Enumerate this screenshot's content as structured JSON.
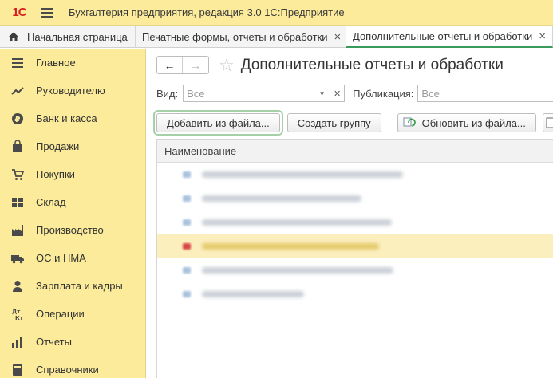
{
  "app": {
    "logo_text": "1С",
    "title": "Бухгалтерия предприятия, редакция 3.0 1С:Предприятие"
  },
  "tabs": [
    {
      "label": "Начальная страница"
    },
    {
      "label": "Печатные формы, отчеты и обработки",
      "close": "×"
    },
    {
      "label": "Дополнительные отчеты и обработки",
      "close": "×",
      "active": true
    }
  ],
  "sidebar": {
    "items": [
      {
        "label": "Главное",
        "icon": "list-icon"
      },
      {
        "label": "Руководителю",
        "icon": "trend-icon"
      },
      {
        "label": "Банк и касса",
        "icon": "ruble-icon"
      },
      {
        "label": "Продажи",
        "icon": "bag-icon"
      },
      {
        "label": "Покупки",
        "icon": "cart-icon"
      },
      {
        "label": "Склад",
        "icon": "warehouse-icon"
      },
      {
        "label": "Производство",
        "icon": "factory-icon"
      },
      {
        "label": "ОС и НМА",
        "icon": "truck-icon"
      },
      {
        "label": "Зарплата и кадры",
        "icon": "person-icon"
      },
      {
        "label": "Операции",
        "icon": "dt-kt-icon"
      },
      {
        "label": "Отчеты",
        "icon": "bar-chart-icon"
      },
      {
        "label": "Справочники",
        "icon": "book-icon"
      }
    ]
  },
  "page": {
    "title": "Дополнительные отчеты и обработки",
    "nav_back": "←",
    "nav_forward": "→",
    "star": "☆"
  },
  "filters": {
    "view_label": "Вид:",
    "view_value": "Все",
    "publication_label": "Публикация:",
    "publication_value": "Все"
  },
  "toolbar": {
    "add_from_file": "Добавить из файла...",
    "create_group": "Создать группу",
    "update_from_file": "Обновить из файла..."
  },
  "table": {
    "header_name": "Наименование"
  },
  "colors": {
    "accent_yellow": "#fbeb9a",
    "active_tab_underline": "#3a9b5c",
    "logo_red": "#d61d1d"
  }
}
